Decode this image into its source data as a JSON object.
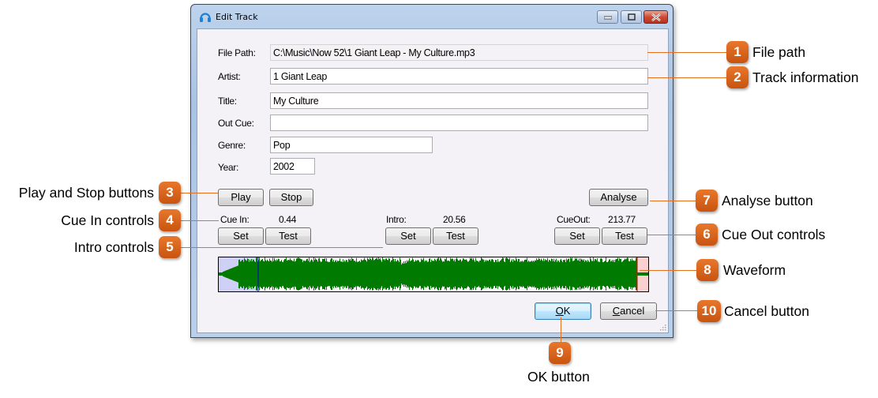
{
  "window": {
    "title": "Edit Track",
    "controls": {
      "minimize": "minimize",
      "maximize": "maximize",
      "close": "close"
    }
  },
  "form": {
    "file_path": {
      "label": "File Path:",
      "value": "C:\\Music\\Now 52\\1 Giant Leap - My Culture.mp3"
    },
    "artist": {
      "label": "Artist:",
      "value": "1 Giant Leap"
    },
    "title": {
      "label": "Title:",
      "value": "My Culture"
    },
    "out_cue": {
      "label": "Out Cue:",
      "value": ""
    },
    "genre": {
      "label": "Genre:",
      "value": "Pop"
    },
    "year": {
      "label": "Year:",
      "value": "2002"
    }
  },
  "playback": {
    "play_label": "Play",
    "stop_label": "Stop",
    "analyse_label": "Analyse"
  },
  "cues": {
    "cue_in": {
      "label": "Cue In:",
      "value": "0.44",
      "set_label": "Set",
      "test_label": "Test"
    },
    "intro": {
      "label": "Intro:",
      "value": "20.56",
      "set_label": "Set",
      "test_label": "Test"
    },
    "cue_out": {
      "label": "CueOut:",
      "value": "213.77",
      "set_label": "Set",
      "test_label": "Test"
    }
  },
  "waveform": {
    "colors": {
      "wave": "#007a00",
      "cue_in_region": "#cfd0f5",
      "cue_in_line": "#0000cc",
      "cue_out_region": "#fbd0d0",
      "cue_out_line": "#e00000"
    }
  },
  "dialog_buttons": {
    "ok_mnemonic": "O",
    "ok_rest": "K",
    "cancel_mnemonic": "C",
    "cancel_rest": "ancel"
  },
  "callouts": [
    {
      "number": "1",
      "label": "File path"
    },
    {
      "number": "2",
      "label": "Track information"
    },
    {
      "number": "3",
      "label": "Play and Stop buttons"
    },
    {
      "number": "4",
      "label": "Cue In controls"
    },
    {
      "number": "5",
      "label": "Intro controls"
    },
    {
      "number": "6",
      "label": "Cue Out controls"
    },
    {
      "number": "7",
      "label": "Analyse button"
    },
    {
      "number": "8",
      "label": "Waveform"
    },
    {
      "number": "9",
      "label": "OK button"
    },
    {
      "number": "10",
      "label": "Cancel button"
    }
  ],
  "accent_color": "#d9621a"
}
